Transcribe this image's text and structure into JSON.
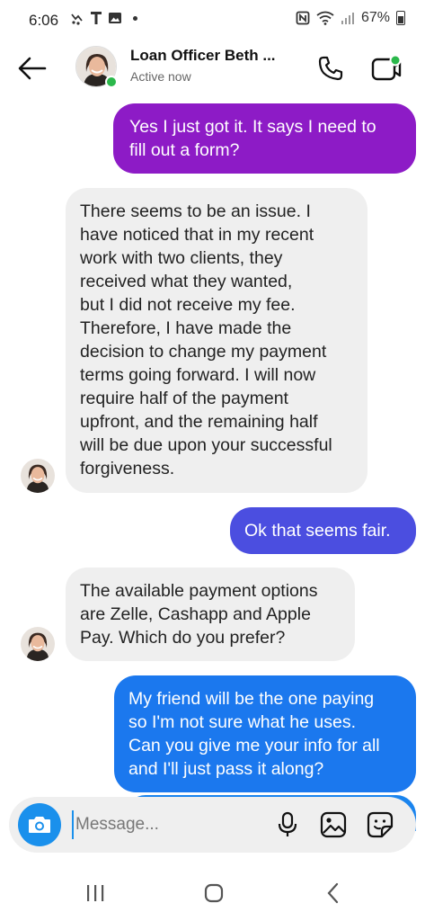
{
  "status_bar": {
    "time": "6:06",
    "battery": "67%"
  },
  "header": {
    "name": "Loan Officer Beth ...",
    "status": "Active now"
  },
  "messages": [
    {
      "direction": "out",
      "color": "#8d1bc6",
      "lines": [
        "Yes I just got it.  It says I need to",
        "fill out a form?"
      ]
    },
    {
      "direction": "in",
      "lines": [
        "There seems to be an issue. I",
        "have noticed that in my recent",
        "work with two clients, they",
        "received what they wanted,",
        "but I did not receive my fee.",
        "Therefore, I have made the",
        "decision to change my payment",
        "terms going forward. I will now",
        "require half of the payment",
        "upfront, and the remaining half",
        "will be due upon your successful",
        "forgiveness."
      ]
    },
    {
      "direction": "out",
      "color": "#4b4ee0",
      "lines": [
        "Ok that seems fair."
      ]
    },
    {
      "direction": "in",
      "lines": [
        "The available payment options",
        "are Zelle, Cashapp and Apple",
        "Pay. Which do you prefer?"
      ]
    },
    {
      "direction": "out",
      "color": "#1b78ee",
      "lines": [
        "My friend will be the one paying",
        "so I'm not sure what he uses.",
        "Can you give me your info for all",
        "and I'll just pass it along?"
      ]
    }
  ],
  "composer": {
    "placeholder": "Message..."
  },
  "colors": {
    "accent": "#1a90ec",
    "online": "#2bb84b",
    "incoming_bubble": "#efefef"
  },
  "icons": {
    "back": "arrow-left-icon",
    "call": "phone-icon",
    "video": "video-camera-icon",
    "camera": "camera-icon",
    "mic": "microphone-icon",
    "gallery": "image-icon",
    "sticker": "sticker-icon"
  }
}
